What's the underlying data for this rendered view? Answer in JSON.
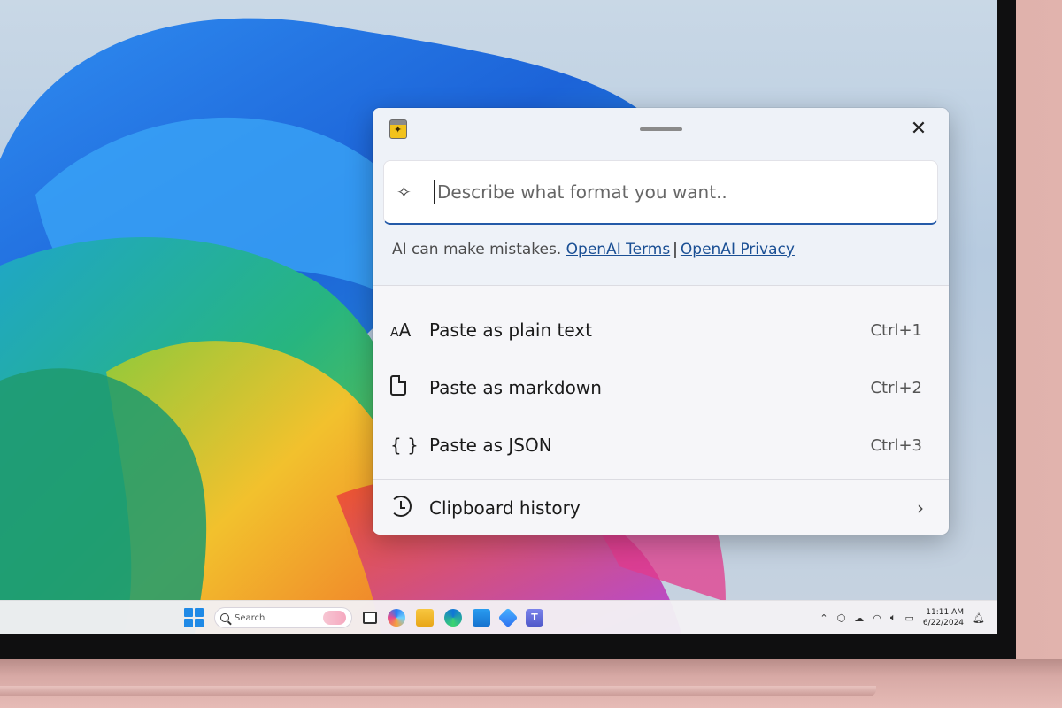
{
  "advanced_paste": {
    "input_placeholder": "Describe what format you want..",
    "disclaimer_text": "AI can make mistakes.",
    "link_terms": "OpenAI Terms",
    "link_separator": "|",
    "link_privacy": "OpenAI Privacy",
    "options": [
      {
        "label": "Paste as plain text",
        "shortcut": "Ctrl+1",
        "icon": "font-size-icon"
      },
      {
        "label": "Paste as markdown",
        "shortcut": "Ctrl+2",
        "icon": "document-icon"
      },
      {
        "label": "Paste as JSON",
        "shortcut": "Ctrl+3",
        "icon": "braces-icon"
      }
    ],
    "clipboard_history_label": "Clipboard history"
  },
  "taskbar": {
    "search_placeholder": "Search",
    "clock_time": "11:11 AM",
    "clock_date": "6/22/2024"
  },
  "colors": {
    "accent": "#245aa8",
    "link": "#1a4f94",
    "start_button": "#1f8ae6"
  }
}
